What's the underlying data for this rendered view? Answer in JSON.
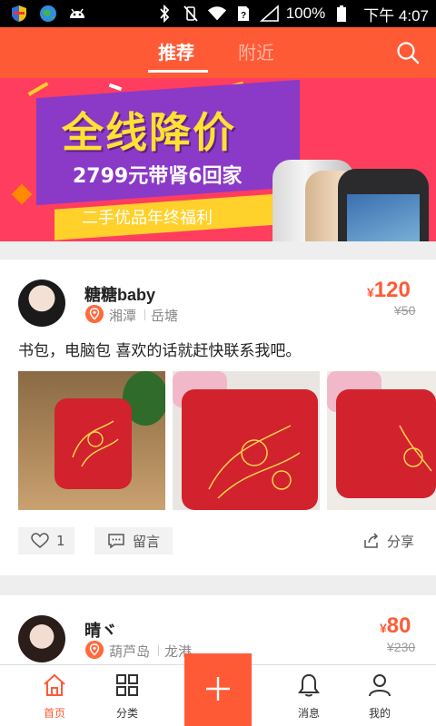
{
  "status_bar": {
    "left_icons": [
      "shield-icon",
      "globe-icon",
      "android-icon"
    ],
    "right_icons": [
      "bluetooth-icon",
      "vibrate-off-icon",
      "wifi-icon",
      "sim-icon",
      "signal-icon",
      "battery-icon"
    ],
    "battery": "100%",
    "time": "下午 4:07"
  },
  "header": {
    "tabs": [
      {
        "label": "推荐",
        "active": true
      },
      {
        "label": "附近",
        "active": false
      }
    ],
    "accent": "#ff5a36"
  },
  "banner": {
    "title": "全线降价",
    "subtitle": "2799元带肾6回家",
    "tagline": "二手优品年终福利"
  },
  "posts": [
    {
      "user": "糖糖baby",
      "location_city": "湘潭",
      "location_district": "岳塘",
      "price": "120",
      "currency": "¥",
      "original_price": "¥50",
      "description": "书包，电脑包  喜欢的话就赶快联系我吧。",
      "likes": "1",
      "comment_label": "留言",
      "share_label": "分享"
    },
    {
      "user": "晴ヾ",
      "location_city": "葫芦岛",
      "location_district": "龙港",
      "price": "80",
      "currency": "¥",
      "original_price": "¥230"
    }
  ],
  "bottom_nav": {
    "items": [
      {
        "label": "首页",
        "icon": "home-icon",
        "active": true
      },
      {
        "label": "分类",
        "icon": "grid-icon",
        "active": false
      },
      {
        "label": "消息",
        "icon": "bell-icon",
        "active": false
      },
      {
        "label": "我的",
        "icon": "person-icon",
        "active": false
      }
    ],
    "fab_icon": "plus-icon"
  }
}
